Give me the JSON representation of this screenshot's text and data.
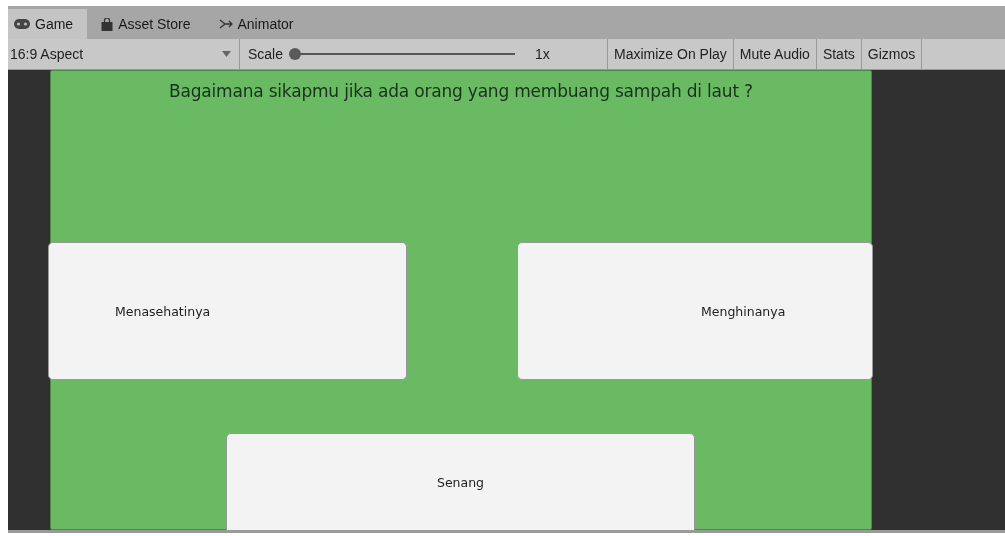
{
  "tabs": [
    {
      "label": "Game",
      "selected": true
    },
    {
      "label": "Asset Store",
      "selected": false
    },
    {
      "label": "Animator",
      "selected": false
    }
  ],
  "toolbar": {
    "aspect": "16:9 Aspect",
    "scale_label": "Scale",
    "scale": {
      "level": 0
    },
    "scale_reading": "1x",
    "buttons": [
      "Maximize On Play",
      "Mute Audio",
      "Stats",
      "Gizmos"
    ]
  },
  "game": {
    "question": "Bagaimana sikapmu jika ada orang yang membuang sampah di laut ?",
    "answers": [
      "Menasehatinya",
      "Menghinanya",
      "Senang"
    ]
  }
}
